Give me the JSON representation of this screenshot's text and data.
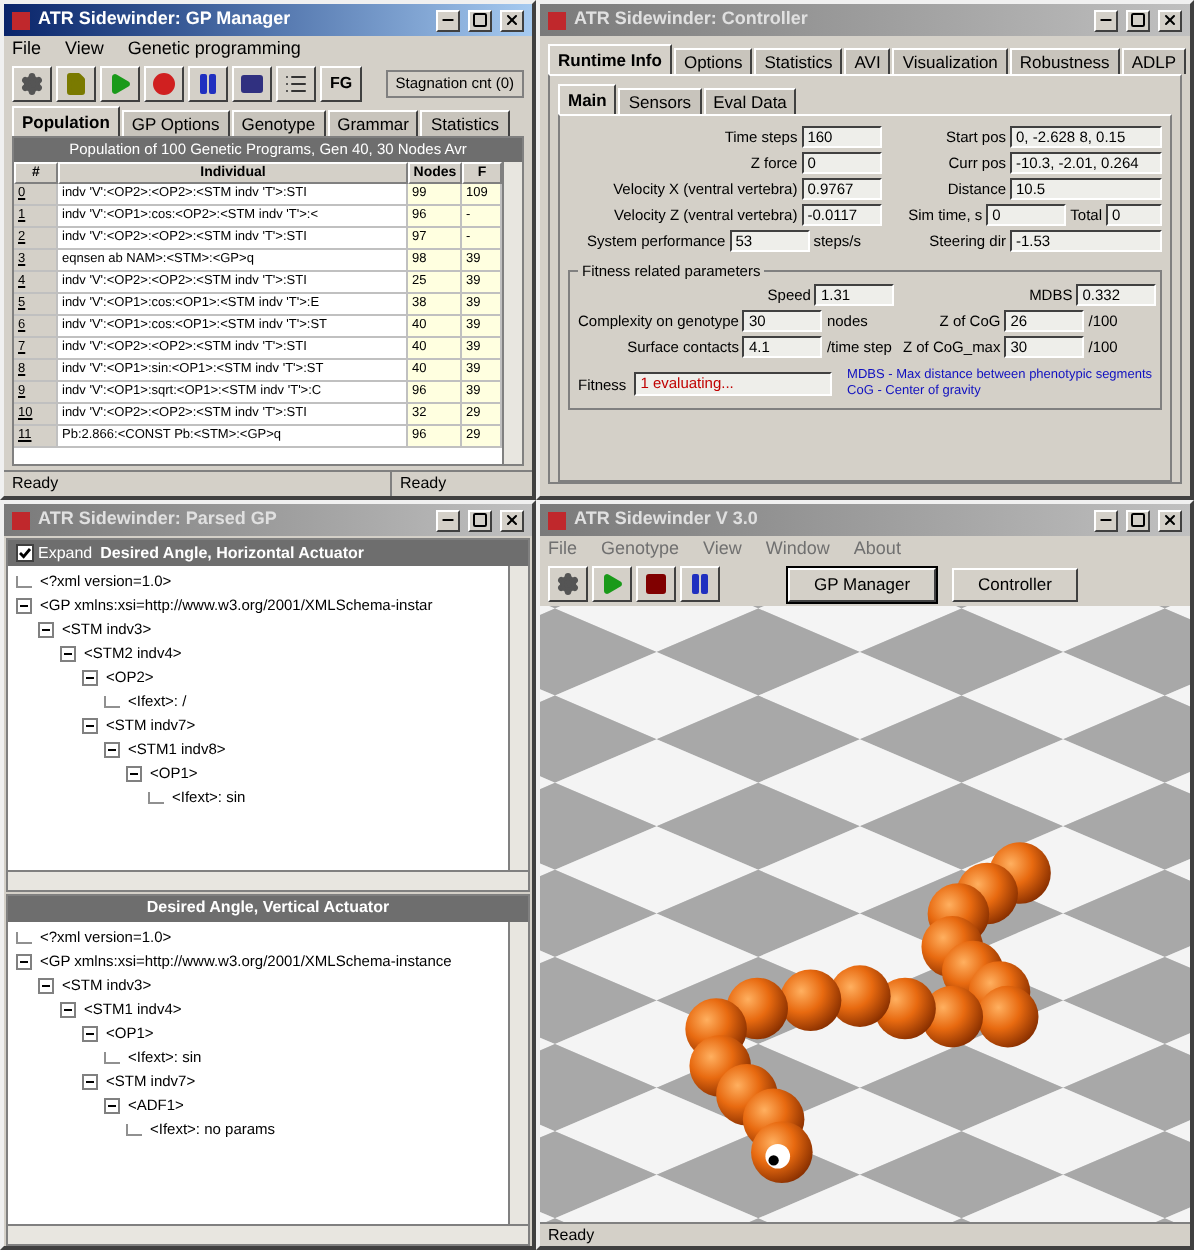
{
  "gp_manager": {
    "title": "ATR Sidewinder: GP Manager",
    "active": true,
    "menu": [
      "File",
      "View",
      "Genetic programming"
    ],
    "toolbar": [
      {
        "kind": "gear"
      },
      {
        "kind": "document"
      },
      {
        "kind": "play"
      },
      {
        "kind": "record"
      },
      {
        "kind": "pause"
      },
      {
        "kind": "window"
      },
      {
        "kind": "list"
      },
      {
        "kind": "text",
        "label": "FG"
      }
    ],
    "stagnation": "Stagnation cnt (0)",
    "tabs": [
      {
        "label": "Population",
        "selected": true
      },
      {
        "label": "GP Options",
        "selected": false
      },
      {
        "label": "Genotype",
        "selected": false
      },
      {
        "label": "Grammar",
        "selected": false
      },
      {
        "label": "Statistics",
        "selected": false
      }
    ],
    "table": {
      "caption": "Population of 100 Genetic Programs, Gen 40, 30 Nodes Avr",
      "columns": [
        "#",
        "Individual",
        "Nodes",
        "F"
      ],
      "rows": [
        [
          "0",
          "indv 'V':<OP2>:<OP2>:<STM indv 'T'>:STI",
          "99",
          "109"
        ],
        [
          "1",
          "indv 'V':<OP1>:cos:<OP2>:<STM indv 'T'>:<",
          "96",
          "-"
        ],
        [
          "2",
          "indv 'V':<OP2>:<OP2>:<STM indv 'T'>:STI",
          "97",
          "-"
        ],
        [
          "3",
          "eqnsen ab NAM>:<STM>:<GP>q",
          "98",
          "39"
        ],
        [
          "4",
          "indv 'V':<OP2>:<OP2>:<STM indv 'T'>:STI",
          "25",
          "39"
        ],
        [
          "5",
          "indv 'V':<OP1>:cos:<OP1>:<STM indv 'T'>:E",
          "38",
          "39"
        ],
        [
          "6",
          "indv 'V':<OP1>:cos:<OP1>:<STM indv 'T'>:ST",
          "40",
          "39"
        ],
        [
          "7",
          "indv 'V':<OP2>:<OP2>:<STM indv 'T'>:STI",
          "40",
          "39"
        ],
        [
          "8",
          "indv 'V':<OP1>:sin:<OP1>:<STM indv 'T'>:ST",
          "40",
          "39"
        ],
        [
          "9",
          "indv 'V':<OP1>:sqrt:<OP1>:<STM indv 'T'>:C",
          "96",
          "39"
        ],
        [
          "10",
          "indv 'V':<OP2>:<OP2>:<STM indv 'T'>:STI",
          "32",
          "29"
        ],
        [
          "11",
          "Pb:2.866:<CONST Pb:<STM>:<GP>q",
          "96",
          "29"
        ]
      ]
    },
    "status": [
      "Ready",
      "Ready"
    ]
  },
  "controller": {
    "title": "ATR Sidewinder: Controller",
    "active": false,
    "tabs": [
      {
        "label": "Runtime Info",
        "selected": true
      },
      {
        "label": "Options",
        "selected": false
      },
      {
        "label": "Statistics",
        "selected": false
      },
      {
        "label": "AVI",
        "selected": false
      },
      {
        "label": "Visualization",
        "selected": false
      },
      {
        "label": "Robustness",
        "selected": false
      },
      {
        "label": "ADLP",
        "selected": false
      }
    ],
    "subtabs": [
      {
        "label": "Main",
        "selected": true
      },
      {
        "label": "Sensors",
        "selected": false
      },
      {
        "label": "Eval Data",
        "selected": false
      }
    ],
    "fields": [
      {
        "label": "Time steps",
        "value": "160"
      },
      {
        "label": "Start pos",
        "value": "0, -2.628 8, 0.15"
      },
      {
        "label": "Z force",
        "value": "0"
      },
      {
        "label": "Curr pos",
        "value": "-10.3, -2.01, 0.264"
      },
      {
        "label": "Velocity X (ventral vertebra)",
        "value": "0.9767"
      },
      {
        "label": "Distance",
        "value": "10.5"
      },
      {
        "label": "Velocity Z (ventral vertebra)",
        "value": "-0.0117"
      },
      {
        "label": "Sim time, s",
        "value": "0",
        "extra_label": "Total",
        "extra_value": "0"
      },
      {
        "label": "System performance",
        "value": "53",
        "unit": "steps/s"
      },
      {
        "label": "Steering dir",
        "value": "-1.53"
      }
    ],
    "group": {
      "title": "Fitness related parameters",
      "fields": [
        {
          "label": "Speed",
          "value": "1.31"
        },
        {
          "label": "MDBS",
          "value": "0.332"
        },
        {
          "label": "Complexity on genotype",
          "value": "30",
          "unit": "nodes"
        },
        {
          "label": "Z of CoG",
          "value": "26",
          "unit": "/100"
        },
        {
          "label": "Surface contacts",
          "value": "4.1",
          "unit": "/time step"
        },
        {
          "label": "Z of CoG_max",
          "value": "30",
          "unit": "/100"
        }
      ],
      "fitness_label": "Fitness",
      "fitness_value": "1 evaluating...",
      "notes": [
        "MDBS - Max distance between phenotypic segments",
        "CoG - Center of gravity"
      ]
    }
  },
  "parsed_gp": {
    "title": "ATR Sidewinder: Parsed GP",
    "active": false,
    "expand": {
      "label": "Expand",
      "checked": true
    },
    "panels": [
      {
        "caption": "Desired Angle, Horizontal Actuator",
        "tree": [
          {
            "label": "<?xml version=1.0>"
          },
          {
            "label": "<GP xmlns:xsi=http://www.w3.org/2001/XMLSchema-instar",
            "expanded": true,
            "children": [
              {
                "label": "<STM indv3>",
                "expanded": true,
                "children": [
                  {
                    "label": "<STM2 indv4>",
                    "expanded": true,
                    "children": [
                      {
                        "label": "<OP2>",
                        "expanded": true,
                        "children": [
                          {
                            "label": "<Ifext>: /"
                          }
                        ]
                      },
                      {
                        "label": "<STM indv7>",
                        "expanded": true,
                        "children": [
                          {
                            "label": "<STM1 indv8>",
                            "expanded": true,
                            "children": [
                              {
                                "label": "<OP1>",
                                "expanded": true,
                                "children": [
                                  {
                                    "label": "<Ifext>: sin"
                                  }
                                ]
                              }
                            ]
                          }
                        ]
                      }
                    ]
                  }
                ]
              }
            ]
          }
        ]
      },
      {
        "caption": "Desired Angle, Vertical Actuator",
        "tree": [
          {
            "label": "<?xml version=1.0>"
          },
          {
            "label": "<GP xmlns:xsi=http://www.w3.org/2001/XMLSchema-instance",
            "expanded": true,
            "children": [
              {
                "label": "<STM indv3>",
                "expanded": true,
                "children": [
                  {
                    "label": "<STM1 indv4>",
                    "expanded": true,
                    "children": [
                      {
                        "label": "<OP1>",
                        "expanded": true,
                        "children": [
                          {
                            "label": "<Ifext>: sin"
                          }
                        ]
                      },
                      {
                        "label": "<STM indv7>",
                        "expanded": true,
                        "children": [
                          {
                            "label": "<ADF1>",
                            "expanded": true,
                            "children": [
                              {
                                "label": "<Ifext>: no params"
                              }
                            ]
                          }
                        ]
                      }
                    ]
                  }
                ]
              }
            ]
          }
        ]
      }
    ]
  },
  "simulation": {
    "title": "ATR Sidewinder V 3.0",
    "active": false,
    "menu": [
      "File",
      "Genotype",
      "View",
      "Window",
      "About"
    ],
    "toolbar": [
      {
        "kind": "gear"
      },
      {
        "kind": "play"
      },
      {
        "kind": "stop"
      },
      {
        "kind": "pause"
      }
    ],
    "buttons": [
      "GP Manager",
      "Controller"
    ],
    "status": "Ready"
  }
}
